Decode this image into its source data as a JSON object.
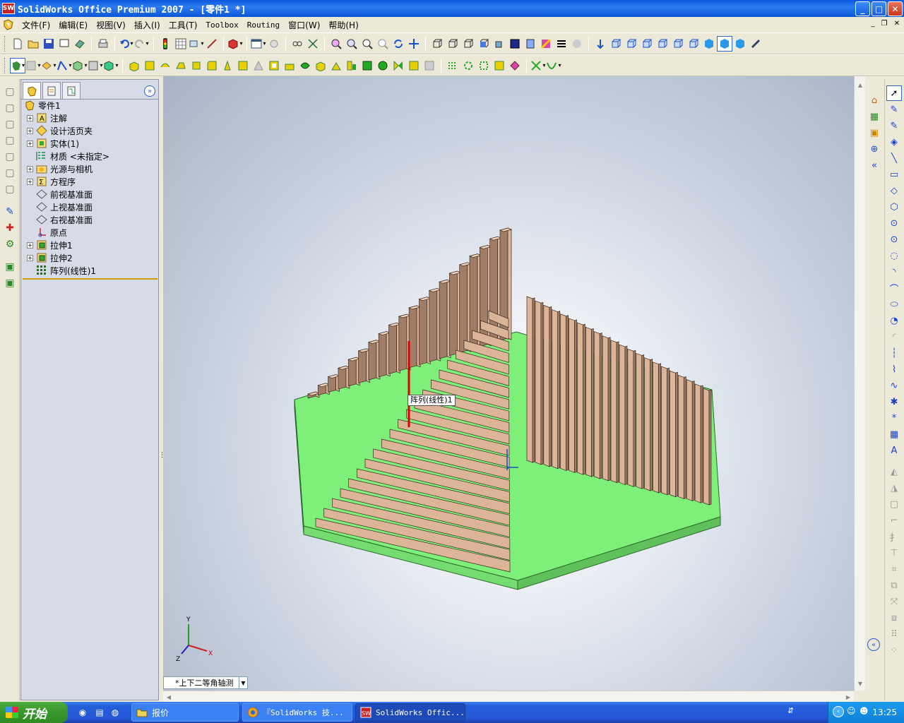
{
  "window": {
    "title": "SolidWorks Office Premium 2007 - [零件1 *]",
    "app_icon": "SW",
    "minimize": "_",
    "maximize": "□",
    "close": "✕"
  },
  "menu": {
    "items": [
      "文件(F)",
      "编辑(E)",
      "视图(V)",
      "插入(I)",
      "工具(T)",
      "Toolbox",
      "Routing",
      "窗口(W)",
      "帮助(H)"
    ],
    "doc_minimize": "_",
    "doc_restore": "❐",
    "doc_close": "✕"
  },
  "toolbars": {
    "standard_icons": [
      "new-icon",
      "open-icon",
      "save-icon",
      "print-icon",
      "undo-icon",
      "redo-icon",
      "rebuild-icon",
      "options-icon",
      "zoom-to-fit-icon",
      "rotate-icon",
      "pan-icon",
      "isometric-view-icon",
      "shaded-icon"
    ],
    "features_icons": [
      "extrude-icon",
      "revolve-icon",
      "sweep-icon",
      "loft-icon",
      "fillet-icon",
      "chamfer-icon",
      "shell-icon",
      "pattern-icon",
      "mirror-icon"
    ]
  },
  "feature_manager": {
    "tabs": [
      "featuremanager-tab",
      "propertymanager-tab",
      "configurationmanager-tab"
    ],
    "collapse_glyph": "»",
    "tree": [
      {
        "label": "零件1",
        "icon": "part-icon",
        "expandable": false,
        "level": 0
      },
      {
        "label": "注解",
        "icon": "annotations-icon",
        "expandable": true,
        "level": 1
      },
      {
        "label": "设计活页夹",
        "icon": "design-binder-icon",
        "expandable": true,
        "level": 1
      },
      {
        "label": "实体(1)",
        "icon": "solid-bodies-icon",
        "expandable": true,
        "level": 1
      },
      {
        "label": "材质 <未指定>",
        "icon": "material-icon",
        "expandable": false,
        "level": 1
      },
      {
        "label": "光源与相机",
        "icon": "lights-cameras-icon",
        "expandable": true,
        "level": 1
      },
      {
        "label": "方程序",
        "icon": "equations-icon",
        "expandable": true,
        "level": 1
      },
      {
        "label": "前视基准面",
        "icon": "plane-icon",
        "expandable": false,
        "level": 1
      },
      {
        "label": "上视基准面",
        "icon": "plane-icon",
        "expandable": false,
        "level": 1
      },
      {
        "label": "右视基准面",
        "icon": "plane-icon",
        "expandable": false,
        "level": 1
      },
      {
        "label": "原点",
        "icon": "origin-icon",
        "expandable": false,
        "level": 1
      },
      {
        "label": "拉伸1",
        "icon": "extrude-feature-icon",
        "expandable": true,
        "level": 1
      },
      {
        "label": "拉伸2",
        "icon": "extrude-feature-icon",
        "expandable": true,
        "level": 1
      },
      {
        "label": "阵列(线性)1",
        "icon": "linear-pattern-icon",
        "expandable": false,
        "level": 1
      }
    ]
  },
  "graphics": {
    "tooltip": "阵列(线性)1",
    "triad": {
      "x": "X",
      "y": "Y",
      "z": "Z"
    },
    "view_orientation": "*上下二等角轴测",
    "colors": {
      "base": "#7ef07a",
      "base_side": "#6ad266",
      "fin_face": "#dcb598",
      "fin_side": "#a17d67",
      "fin_top": "#f0d4bc",
      "highlight": "#e00000"
    }
  },
  "taskbar": {
    "start": "开始",
    "tasks": [
      {
        "label": "报价",
        "icon": "folder-icon",
        "active": false
      },
      {
        "label": "『SolidWorks 技...",
        "icon": "browser-icon",
        "active": false
      },
      {
        "label": "SolidWorks Offic...",
        "icon": "solidworks-icon",
        "active": true
      }
    ],
    "clock": "13:25"
  }
}
